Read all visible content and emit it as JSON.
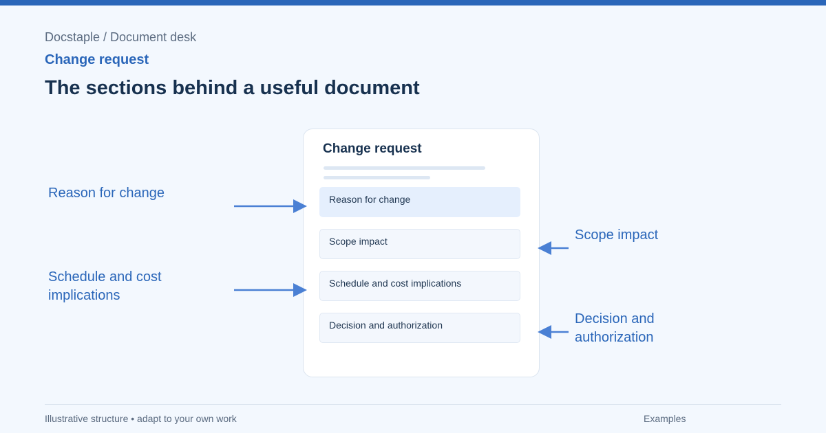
{
  "header": {
    "breadcrumb": "Docstaple / Document desk",
    "kicker": "Change request",
    "title": "The sections behind a useful document"
  },
  "document": {
    "title": "Change request",
    "sections": [
      {
        "label": "Reason for change",
        "highlighted": true
      },
      {
        "label": "Scope impact",
        "highlighted": false
      },
      {
        "label": "Schedule and cost implications",
        "highlighted": false
      },
      {
        "label": "Decision and authorization",
        "highlighted": false
      }
    ]
  },
  "callouts": {
    "left": [
      "Reason for change",
      "Schedule and cost implications"
    ],
    "right": [
      "Scope impact",
      "Decision and authorization"
    ]
  },
  "footer": {
    "note": "Illustrative structure • adapt to your own work",
    "link": "Examples"
  },
  "colors": {
    "accent": "#2a66b9",
    "arrow": "#4a80d4",
    "heading": "#17314f",
    "background": "#f3f8fe"
  }
}
